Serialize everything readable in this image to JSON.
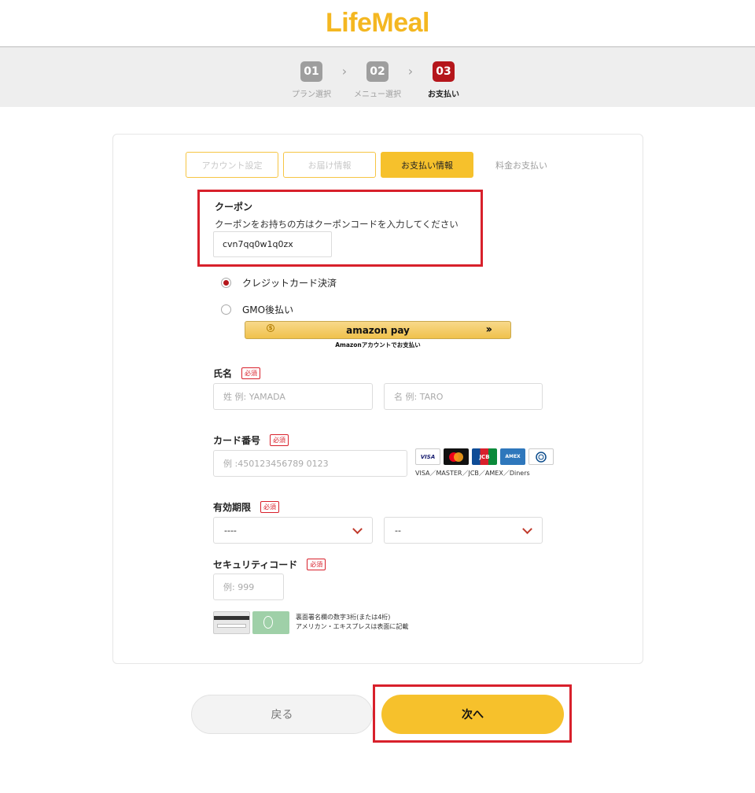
{
  "header": {
    "logo": "LifeMeal",
    "brand_color": "#f4b721"
  },
  "steps": [
    {
      "num": "01",
      "label": "プラン選択",
      "active": false
    },
    {
      "num": "02",
      "label": "メニュー選択",
      "active": false
    },
    {
      "num": "03",
      "label": "お支払い",
      "active": true
    }
  ],
  "subtabs": [
    "アカウント設定",
    "お届け情報",
    "お支払い情報",
    "料金お支払い"
  ],
  "coupon": {
    "title": "クーポン",
    "description": "クーポンをお持ちの方はクーポンコードを入力してください",
    "value": "cvn7qq0w1q0zx"
  },
  "payment": {
    "credit_label": "クレジットカード決済",
    "gmo_label": "GMO後払い",
    "amazon_label": "amazon pay",
    "amazon_sub": "Amazonアカウントでお支払い"
  },
  "form": {
    "required": "必須",
    "name_label": "氏名",
    "last_placeholder": "姓 例: YAMADA",
    "first_placeholder": "名 例: TARO",
    "card_label": "カード番号",
    "card_placeholder": "例 :450123456789 0123",
    "card_brands": [
      "VISA",
      "MC",
      "JCB",
      "AMEX",
      "Diners"
    ],
    "card_brands_text": "VISA／MASTER／JCB／AMEX／Diners",
    "expiry_label": "有効期限",
    "expiry_month": "----",
    "expiry_year": "--",
    "security_label": "セキュリティコード",
    "security_placeholder": "例: 999",
    "security_note_1": "裏面署名欄の数字3桁(または4桁)",
    "security_note_2": "アメリカン・エキスプレスは表面に記載"
  },
  "buttons": {
    "back": "戻る",
    "next": "次へ"
  },
  "colors": {
    "accent": "#f6c12c",
    "active_step": "#b5161b",
    "highlight": "#d8202b"
  }
}
